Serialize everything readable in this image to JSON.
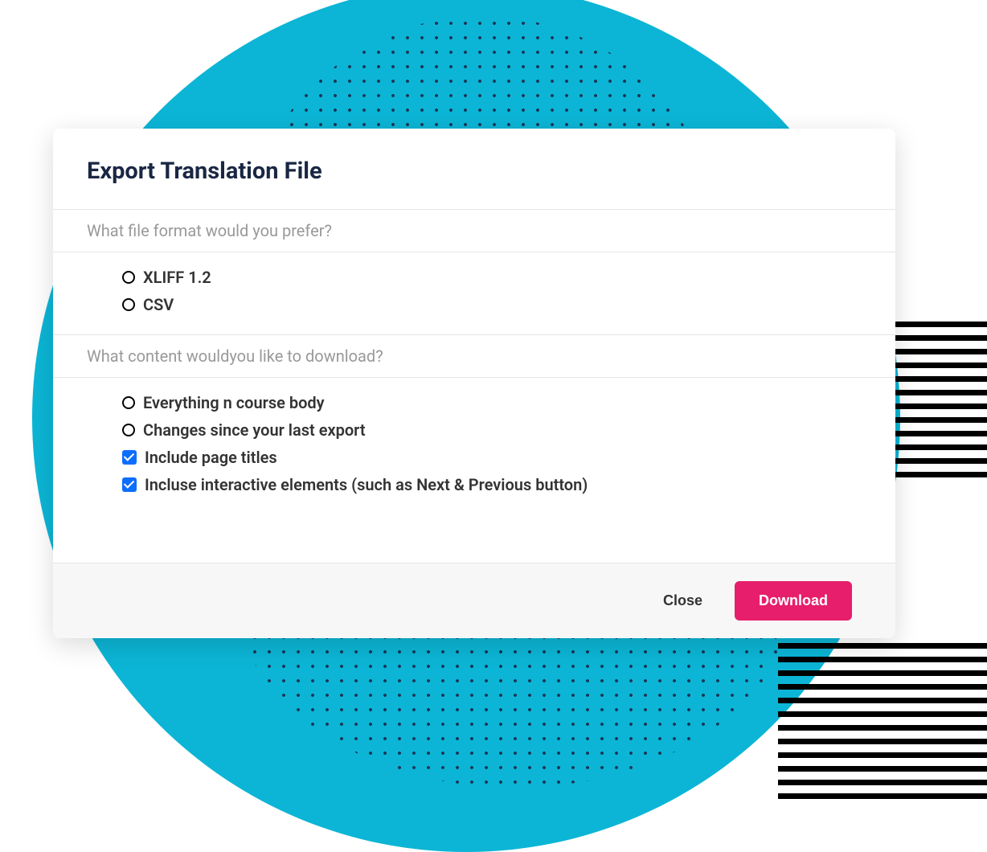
{
  "dialog": {
    "title": "Export Translation File",
    "section1_label": "What file format would you prefer?",
    "format_options": [
      {
        "label": "XLIFF 1.2"
      },
      {
        "label": "CSV"
      }
    ],
    "section2_label": "What content wouldyou like to download?",
    "content_radio_options": [
      {
        "label": "Everything n course body"
      },
      {
        "label": "Changes since your last export"
      }
    ],
    "content_checkbox_options": [
      {
        "label": "Include page titles"
      },
      {
        "label": "Incluse interactive elements (such as Next & Previous button)"
      }
    ],
    "buttons": {
      "close": "Close",
      "download": "Download"
    }
  }
}
